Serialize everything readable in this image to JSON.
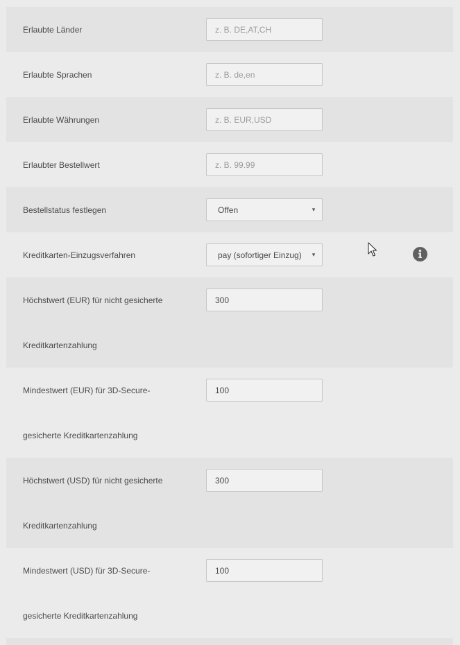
{
  "form": {
    "allowed_countries": {
      "label": "Erlaubte Länder",
      "value": "",
      "placeholder": "z. B. DE,AT,CH"
    },
    "allowed_languages": {
      "label": "Erlaubte Sprachen",
      "value": "",
      "placeholder": "z. B. de,en"
    },
    "allowed_currencies": {
      "label": "Erlaubte Währungen",
      "value": "",
      "placeholder": "z. B. EUR,USD"
    },
    "allowed_order_value": {
      "label": "Erlaubter Bestellwert",
      "value": "",
      "placeholder": "z. B. 99.99"
    },
    "order_status": {
      "label": "Bestellstatus festlegen",
      "selected": "Offen",
      "arrow": "▾"
    },
    "card_capture_method": {
      "label": "Kreditkarten-Einzugsverfahren",
      "selected": "pay (sofortiger Einzug)",
      "arrow": "▾",
      "info_icon": "info-icon"
    },
    "max_eur_unsecured": {
      "label_line1": "Höchstwert (EUR) für nicht gesicherte",
      "label_line2": "Kreditkartenzahlung",
      "value": "300"
    },
    "min_eur_3ds": {
      "label_line1": "Mindestwert (EUR) für 3D-Secure-",
      "label_line2": "gesicherte Kreditkartenzahlung",
      "value": "100"
    },
    "max_usd_unsecured": {
      "label_line1": "Höchstwert (USD) für nicht gesicherte",
      "label_line2": "Kreditkartenzahlung",
      "value": "300"
    },
    "min_usd_3ds": {
      "label_line1": "Mindestwert (USD) für 3D-Secure-",
      "label_line2": "gesicherte Kreditkartenzahlung",
      "value": "100"
    }
  },
  "colors": {
    "page_background": "#ebebeb",
    "shaded_row": "#e3e3e3",
    "field_border": "#c6c6c6",
    "info_icon": "#606060"
  }
}
